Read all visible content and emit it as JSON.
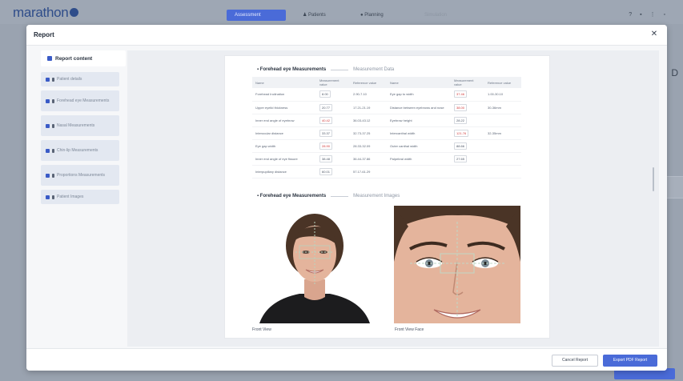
{
  "app": {
    "logo_text": "marathon",
    "nav_tabs": [
      "Assessment",
      "Patients",
      "Planning",
      "Simulation"
    ]
  },
  "modal": {
    "title": "Report",
    "close_icon": "close-icon"
  },
  "sidebar": {
    "header": "Report content",
    "items": [
      {
        "label": "Patient details"
      },
      {
        "label": "Forehead eye Measurements"
      },
      {
        "label": "Nasal Measurements"
      },
      {
        "label": "Chin-lip Measurements"
      },
      {
        "label": "Proportions Measurements"
      },
      {
        "label": "Patient Images"
      }
    ]
  },
  "section1": {
    "title": "Forehead eye Measurements",
    "subtitle": "Measurement Data"
  },
  "table": {
    "headers": [
      "Name",
      "Measurement value",
      "Reference value",
      "Name",
      "Measurement value",
      "Reference value"
    ],
    "rows": [
      {
        "n1": "Forehead Inclination",
        "v1": "8.00",
        "r1": "2.90-7.10",
        "red1": false,
        "n2": "Eye gap to width",
        "v2": "37.46",
        "r2": "1.00-30.10",
        "red2": true
      },
      {
        "n1": "Upper eyelid thickness",
        "v1": "20.77",
        "r1": "17.21-21.19",
        "red1": false,
        "n2": "Distance between eyebrows and nose",
        "v2": "38.00",
        "r2": "30-36mm",
        "red2": true
      },
      {
        "n1": "Inner end angle of eyebrow",
        "v1": "40.42",
        "r1": "36.03-43.12",
        "red1": true,
        "n2": "Eyebrow height",
        "v2": "28.22",
        "r2": "",
        "red2": false
      },
      {
        "n1": "Interocular distance",
        "v1": "33.37",
        "r1": "32.73-37.25",
        "red1": false,
        "n2": "Intercanthal width",
        "v2": "121.76",
        "r2": "32-35mm",
        "red2": true
      },
      {
        "n1": "Eye gap width",
        "v1": "28.90",
        "r1": "28.33-32.09",
        "red1": true,
        "n2": "Outer canthal width",
        "v2": "88.66",
        "r2": "",
        "red2": false
      },
      {
        "n1": "Inner end angle of eye fissure",
        "v1": "38.48",
        "r1": "36.44-37.86",
        "red1": false,
        "n2": "Palpebral width",
        "v2": "27.65",
        "r2": "",
        "red2": false
      },
      {
        "n1": "Interpupillary distance",
        "v1": "60.01",
        "r1": "57.17-61.29",
        "red1": false,
        "n2": "",
        "v2": "",
        "r2": "",
        "red2": false
      }
    ]
  },
  "section2": {
    "title": "Forehead eye Measurements",
    "subtitle": "Measurement Images"
  },
  "images": {
    "left_caption": "Front View",
    "right_caption": "Front View Face"
  },
  "footer": {
    "cancel_label": "Cancel Report",
    "export_label": "Export PDF Report"
  },
  "colors": {
    "accent": "#4a6bd8",
    "danger": "#d23a3a"
  }
}
